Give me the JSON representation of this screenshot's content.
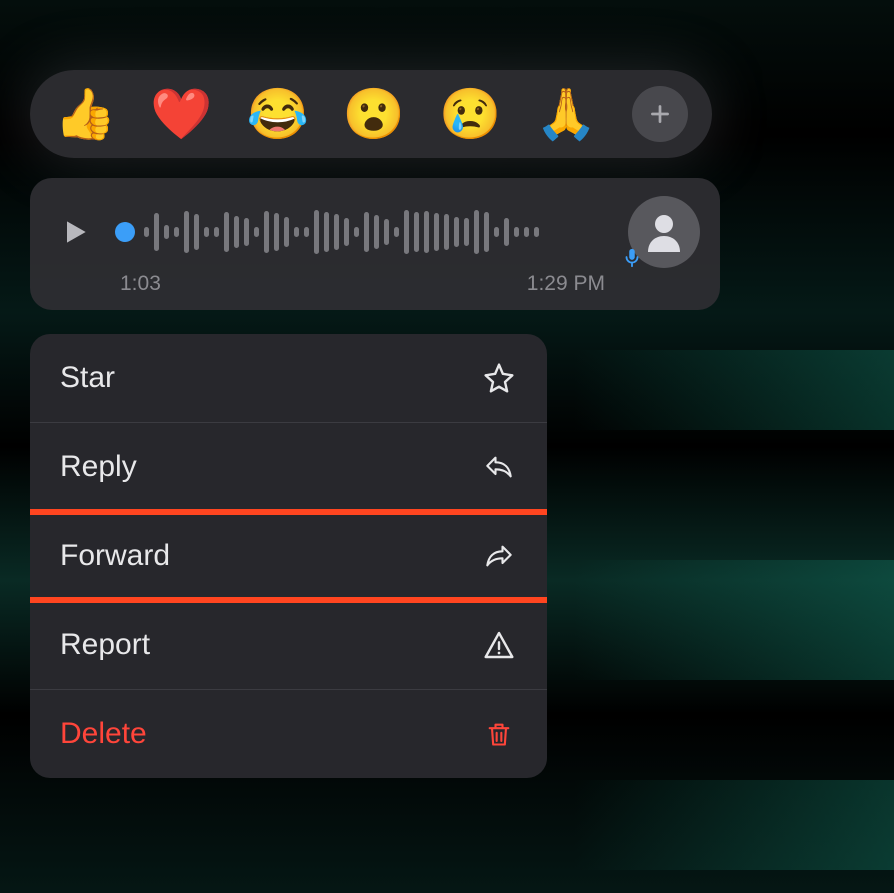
{
  "reactions": {
    "emojis": [
      "👍",
      "❤️",
      "😂",
      "😮",
      "😢",
      "🙏"
    ]
  },
  "voice_message": {
    "duration": "1:03",
    "timestamp": "1:29 PM"
  },
  "menu": {
    "items": [
      {
        "label": "Star",
        "icon": "star-icon",
        "danger": false
      },
      {
        "label": "Reply",
        "icon": "reply-icon",
        "danger": false
      },
      {
        "label": "Forward",
        "icon": "forward-icon",
        "danger": false,
        "highlighted": true
      },
      {
        "label": "Report",
        "icon": "warning-icon",
        "danger": false
      },
      {
        "label": "Delete",
        "icon": "trash-icon",
        "danger": true
      }
    ]
  },
  "colors": {
    "accent_blue": "#3b9ef8",
    "danger_red": "#ff453a",
    "highlight_orange": "#ff4520"
  }
}
